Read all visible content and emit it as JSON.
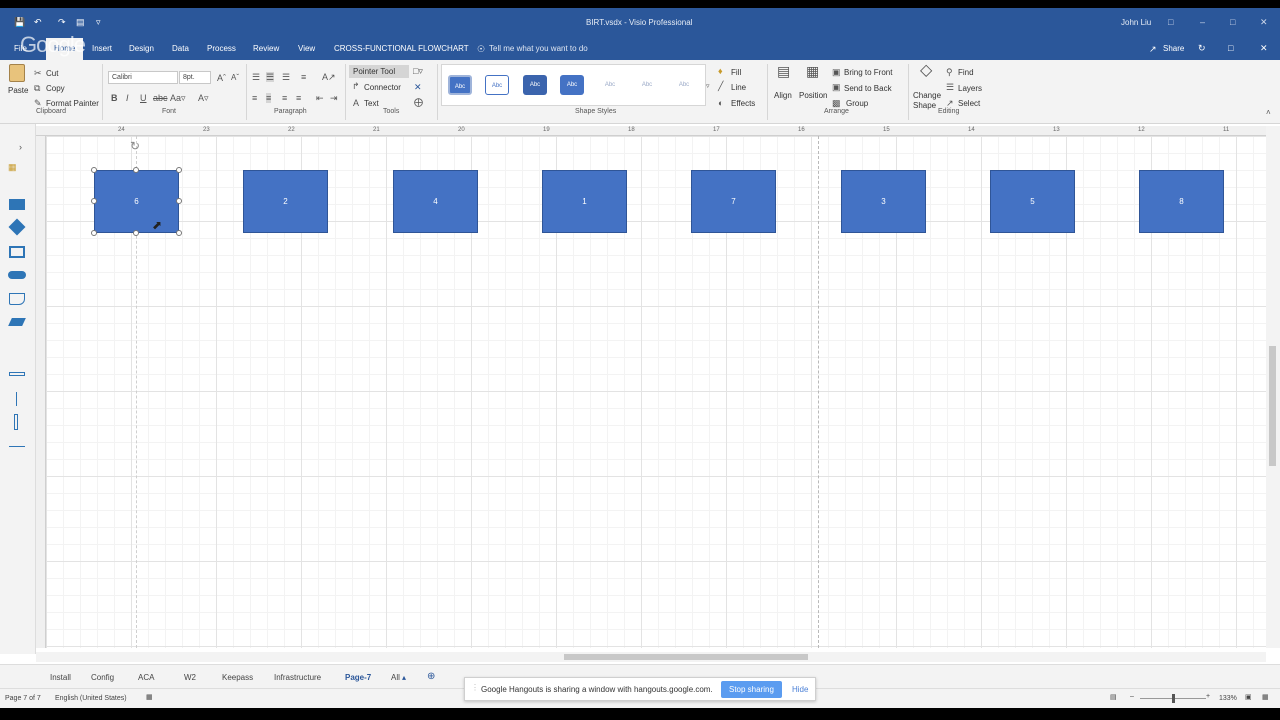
{
  "window": {
    "title": "BIRT.vsdx - Visio Professional",
    "user": "John Liu"
  },
  "overlay_logo": "Google",
  "tabs": {
    "file": "File",
    "home": "Home",
    "insert": "Insert",
    "design": "Design",
    "data": "Data",
    "process": "Process",
    "review": "Review",
    "view": "View",
    "cross": "CROSS-FUNCTIONAL FLOWCHART",
    "tell": "Tell me what you want to do",
    "share": "Share"
  },
  "ribbon": {
    "paste": "Paste",
    "cut": "Cut",
    "copy": "Copy",
    "format_painter": "Format Painter",
    "clipboard": "Clipboard",
    "font_name": "Calibri",
    "font_size": "8pt.",
    "font": "Font",
    "paragraph": "Paragraph",
    "pointer_tool": "Pointer Tool",
    "connector": "Connector",
    "text": "Text",
    "tools": "Tools",
    "style_label": "Abc",
    "shape_styles": "Shape Styles",
    "fill": "Fill",
    "line": "Line",
    "effects": "Effects",
    "align": "Align",
    "position": "Position",
    "bring_front": "Bring to Front",
    "send_back": "Send to Back",
    "group": "Group",
    "arrange": "Arrange",
    "change_shape_1": "Change",
    "change_shape_2": "Shape",
    "find": "Find",
    "layers": "Layers",
    "select": "Select",
    "editing": "Editing"
  },
  "ruler_ticks": [
    "24",
    "23",
    "22",
    "21",
    "20",
    "19",
    "18",
    "17",
    "16",
    "15",
    "14",
    "13",
    "12",
    "11"
  ],
  "shapes": [
    "6",
    "2",
    "4",
    "1",
    "7",
    "3",
    "5",
    "8"
  ],
  "colors": {
    "shape_fill": "#4472c4",
    "title_bar": "#2b579a"
  },
  "page_tabs": [
    "Install",
    "Config",
    "ACA",
    "W2",
    "Keepass",
    "Infrastructure",
    "Page-7",
    "All"
  ],
  "active_page": "Page-7",
  "hangouts": {
    "message": "Google Hangouts is sharing a window with hangouts.google.com.",
    "stop": "Stop sharing",
    "hide": "Hide"
  },
  "status": {
    "page": "Page 7 of 7",
    "language": "English (United States)",
    "zoom": "133%"
  }
}
